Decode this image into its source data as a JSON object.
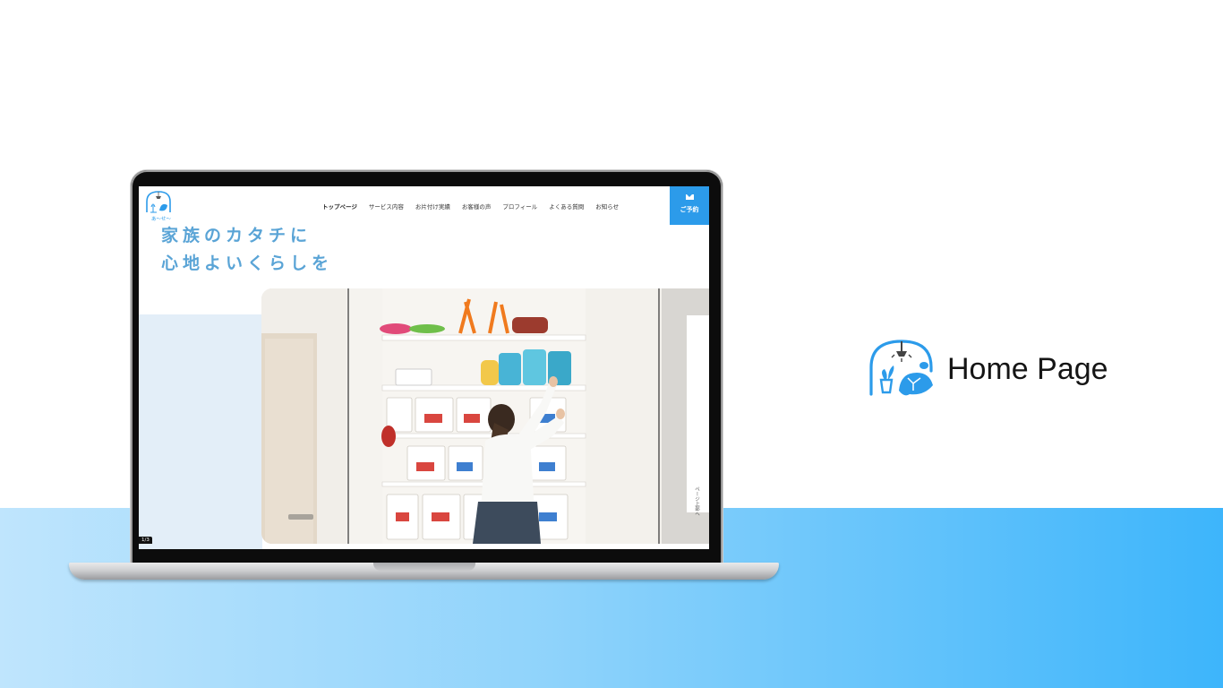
{
  "colors": {
    "accent": "#2c9bea",
    "hero_text": "#5aa4d6",
    "band_start": "#bfe5fd",
    "band_end": "#3db5fb"
  },
  "screen": {
    "logo_icon": "house-logo-icon",
    "nav": [
      "トップページ",
      "サービス内容",
      "お片付け実績",
      "お客様の声",
      "プロフィール",
      "よくある質問",
      "お知らせ"
    ],
    "reserve_label": "ご予約",
    "hero_line1": "家族のカタチに",
    "hero_line2": "心地よいくらしを",
    "slide_counter": "1/3",
    "side_tab": "ページ上部へ"
  },
  "label": {
    "title": "Home Page",
    "icon": "house-plant-turtle-icon"
  }
}
